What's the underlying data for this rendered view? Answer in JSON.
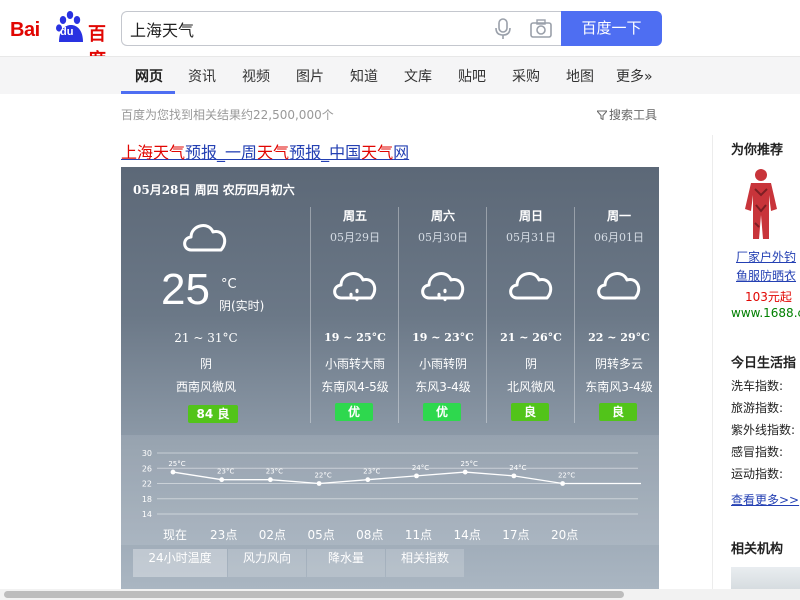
{
  "logo": {
    "bai": "Bai",
    "du": "du",
    "cn": "百度"
  },
  "search": {
    "value": "上海天气",
    "button": "百度一下"
  },
  "nav": [
    "网页",
    "资讯",
    "视频",
    "图片",
    "知道",
    "文库",
    "贴吧",
    "采购",
    "地图",
    "更多»"
  ],
  "result_count": "百度为您找到相关结果约22,500,000个",
  "search_tools": "搜索工具",
  "result_title_parts": [
    "上海",
    "天气",
    "预报_一周",
    "天气",
    "预报_中国",
    "天气",
    "网"
  ],
  "weather": {
    "date": "05月28日 周四 农历四月初六",
    "today": {
      "temp": "25",
      "unit": "°C",
      "desc": "阴(实时)",
      "range": "21 ~ 31°C",
      "cond": "阴",
      "wind": "西南风微风",
      "aqi": "84 良"
    },
    "days": [
      {
        "name": "周五",
        "date": "05月29日",
        "icon": "rain-cloud-icon",
        "range": "19 ~ 25°C",
        "cond": "小雨转大雨",
        "wind": "东南风4-5级",
        "aqi": "优"
      },
      {
        "name": "周六",
        "date": "05月30日",
        "icon": "rain-cloud-icon",
        "range": "19 ~ 23°C",
        "cond": "小雨转阴",
        "wind": "东风3-4级",
        "aqi": "优"
      },
      {
        "name": "周日",
        "date": "05月31日",
        "icon": "cloud-icon",
        "range": "21 ~ 26°C",
        "cond": "阴",
        "wind": "北风微风",
        "aqi": "良"
      },
      {
        "name": "周一",
        "date": "06月01日",
        "icon": "cloud-icon",
        "range": "22 ~ 29°C",
        "cond": "阴转多云",
        "wind": "东南风3-4级",
        "aqi": "良"
      }
    ],
    "aqi_colors": {
      "优": "#2ed84e",
      "良": "#52c41a"
    }
  },
  "chart_data": {
    "type": "line",
    "categories": [
      "现在",
      "23点",
      "02点",
      "05点",
      "08点",
      "11点",
      "14点",
      "17点",
      "20点"
    ],
    "values": [
      25,
      23,
      23,
      22,
      23,
      24,
      25,
      24,
      22
    ],
    "point_labels": [
      "25°C",
      "23°C",
      "23°C",
      "22°C",
      "23°C",
      "24°C",
      "25°C",
      "24°C",
      "22°C"
    ],
    "y_ticks": [
      30,
      26,
      22,
      18,
      14
    ],
    "ylim": [
      14,
      30
    ],
    "grid": true
  },
  "hourly_tabs": [
    "24小时温度",
    "风力风向",
    "降水量",
    "相关指数"
  ],
  "rail": {
    "recommend_title": "为你推荐",
    "product_lines": [
      "厂家户外钓",
      "鱼服防晒衣"
    ],
    "price": "103元起",
    "url": "www.1688.c",
    "life_title": "今日生活指",
    "life_items": [
      "洗车指数:",
      "旅游指数:",
      "紫外线指数:",
      "感冒指数:",
      "运动指数:"
    ],
    "more": "查看更多>>",
    "org_title": "相关机构"
  }
}
